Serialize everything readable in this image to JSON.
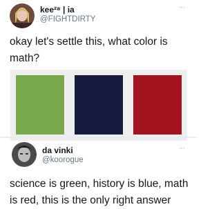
{
  "tweet1": {
    "display_name": "kee²⁸ | ia",
    "handle": "@FIGHTDIRTY",
    "more": "···",
    "avatar_icon": "user-avatar-photo",
    "text": "okay let's settle this, what color is math?",
    "swatches": [
      {
        "name": "green",
        "color": "#79a84a"
      },
      {
        "name": "navy",
        "color": "#161a3e"
      },
      {
        "name": "red",
        "color": "#a41220"
      }
    ]
  },
  "tweet2": {
    "display_name": "da vinki",
    "handle": "@koorogue",
    "more": "···",
    "avatar_icon": "user-avatar-photo",
    "text": "science is green, history is blue, math is red, this is the only right answer"
  }
}
